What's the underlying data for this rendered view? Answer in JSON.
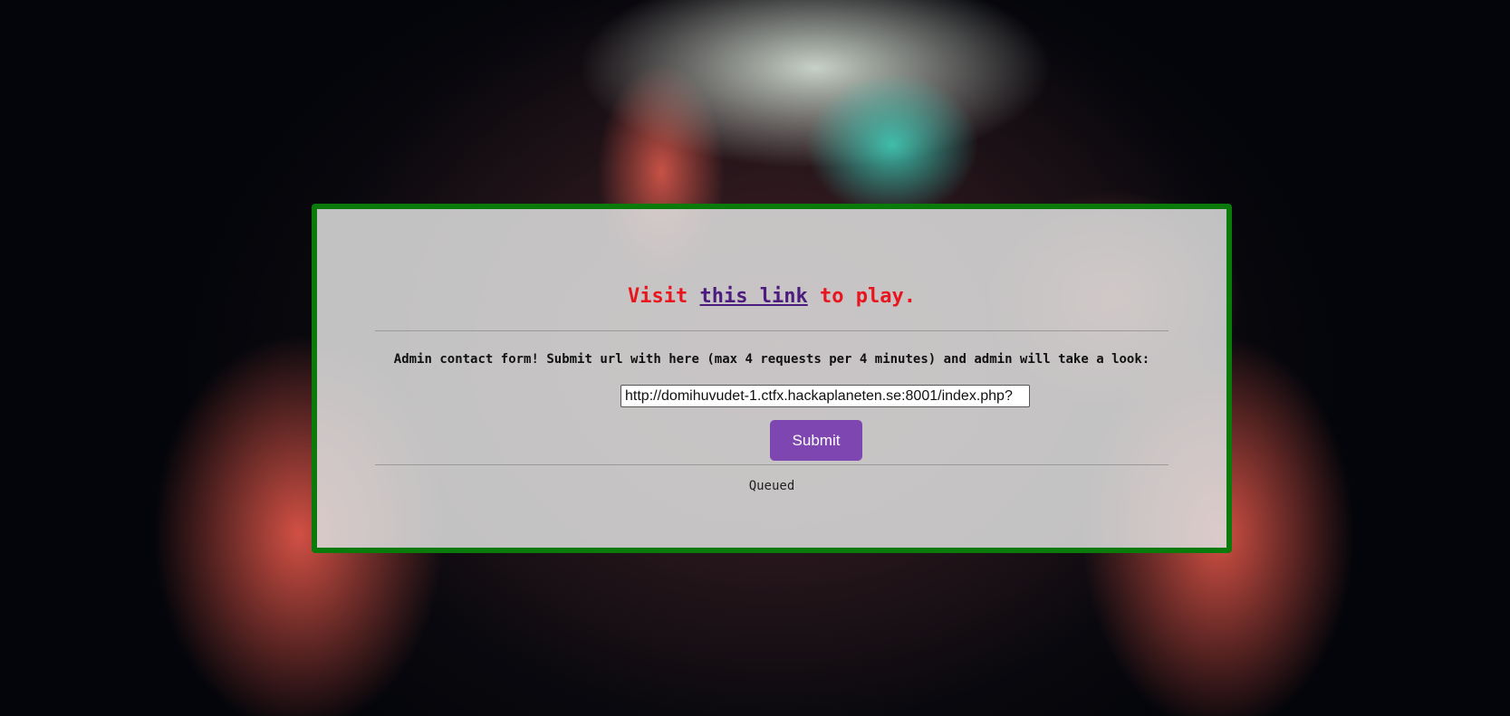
{
  "headline": {
    "prefix": "Visit ",
    "link_text": "this link",
    "suffix": " to play."
  },
  "contact_form": {
    "prompt": "Admin contact form! Submit url with here (max 4 requests per 4 minutes) and admin will take a look:",
    "url_value": "http://domihuvudet-1.ctfx.hackaplaneten.se:8001/index.php?",
    "submit_label": "Submit"
  },
  "status": {
    "text": "Queued"
  },
  "colors": {
    "panel_border": "#0a7a0a",
    "headline_text": "#e8141e",
    "link": "#4b1b7e",
    "button": "#7e46b1"
  }
}
